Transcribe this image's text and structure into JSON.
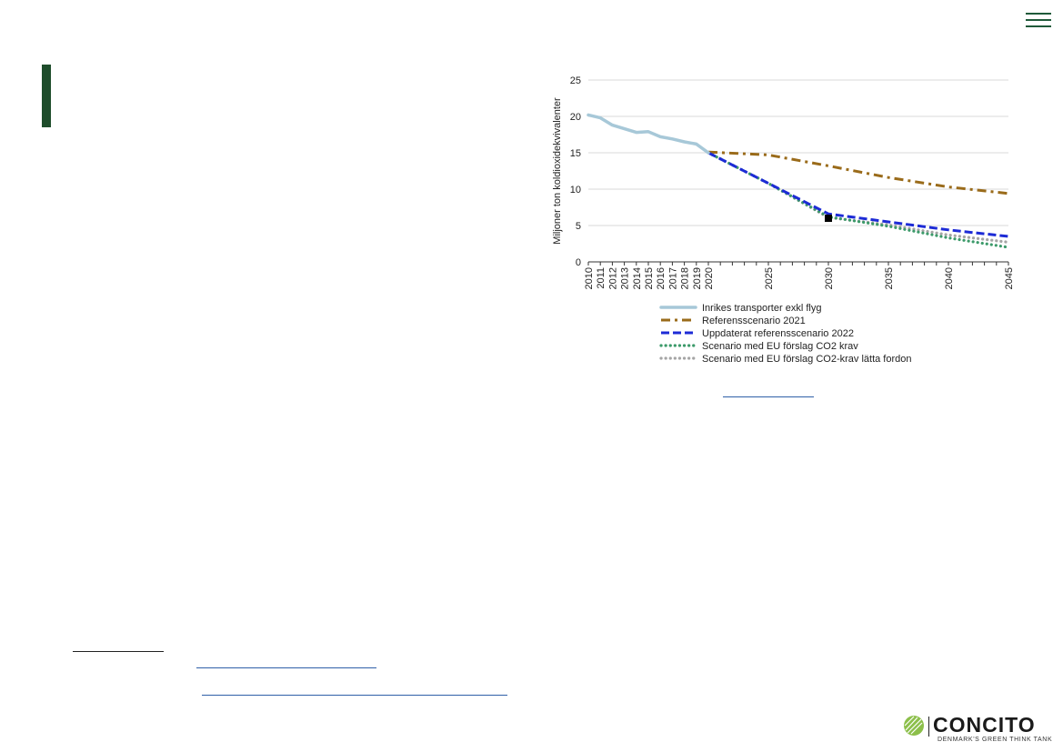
{
  "chart_data": {
    "type": "line",
    "ylabel": "Miljoner ton koldioxidekvivalenter",
    "ylim": [
      0,
      25
    ],
    "y_ticks": [
      0,
      5,
      10,
      15,
      20,
      25
    ],
    "xlim": [
      2010,
      2045
    ],
    "x_ticks": [
      "2010",
      "2011",
      "2012",
      "2013",
      "2014",
      "2015",
      "2016",
      "2017",
      "2018",
      "2019",
      "2020",
      "2025",
      "2030",
      "2035",
      "2040",
      "2045"
    ],
    "grid": "horizontal",
    "legend_position": "bottom",
    "marker": {
      "x": 2030,
      "y": 6.0
    },
    "series": [
      {
        "name": "Inrikes transporter exkl flyg",
        "color": "#a7c8d8",
        "style": "solid",
        "points": [
          [
            2010,
            20.2
          ],
          [
            2011,
            19.8
          ],
          [
            2012,
            18.8
          ],
          [
            2013,
            18.3
          ],
          [
            2014,
            17.8
          ],
          [
            2015,
            17.9
          ],
          [
            2016,
            17.2
          ],
          [
            2017,
            16.9
          ],
          [
            2018,
            16.5
          ],
          [
            2019,
            16.2
          ],
          [
            2020,
            15.0
          ]
        ]
      },
      {
        "name": "Referensscenario 2021",
        "color": "#9a6b1a",
        "style": "dashdot",
        "points": [
          [
            2020,
            15.1
          ],
          [
            2025,
            14.7
          ],
          [
            2030,
            13.2
          ],
          [
            2035,
            11.6
          ],
          [
            2040,
            10.3
          ],
          [
            2045,
            9.4
          ]
        ]
      },
      {
        "name": "Uppdaterat referensscenario 2022",
        "color": "#1d2bd6",
        "style": "dashed",
        "points": [
          [
            2020,
            15.0
          ],
          [
            2025,
            10.8
          ],
          [
            2030,
            6.6
          ],
          [
            2035,
            5.5
          ],
          [
            2040,
            4.4
          ],
          [
            2045,
            3.5
          ]
        ]
      },
      {
        "name": "Scenario med EU förslag CO2 krav",
        "color": "#3c9a6a",
        "style": "dotted",
        "points": [
          [
            2020,
            15.0
          ],
          [
            2025,
            10.8
          ],
          [
            2030,
            6.2
          ],
          [
            2035,
            4.9
          ],
          [
            2040,
            3.3
          ],
          [
            2045,
            2.0
          ]
        ]
      },
      {
        "name": "Scenario med EU förslag CO2-krav lätta fordon",
        "color": "#a5a5a5",
        "style": "dotted",
        "points": [
          [
            2020,
            15.0
          ],
          [
            2025,
            10.8
          ],
          [
            2030,
            6.1
          ],
          [
            2035,
            5.1
          ],
          [
            2040,
            3.7
          ],
          [
            2045,
            2.7
          ]
        ]
      }
    ]
  },
  "logo": {
    "wordmark": "CONCITO",
    "tagline": "DENMARK'S GREEN THINK TANK"
  }
}
